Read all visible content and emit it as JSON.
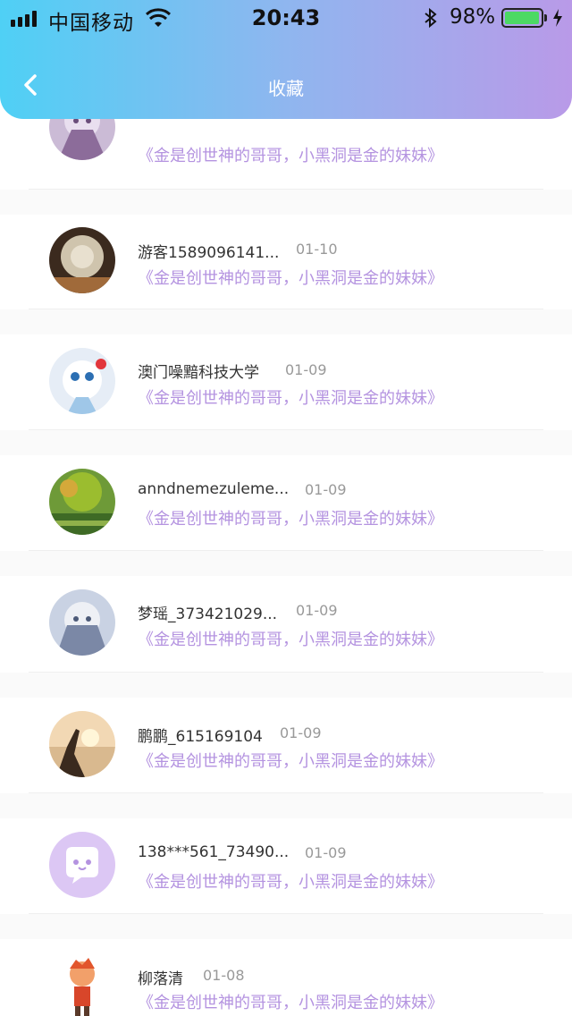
{
  "status_bar": {
    "carrier": "中国移动",
    "time": "20:43",
    "battery": "98%",
    "battery_level": 0.98
  },
  "nav": {
    "back_icon": "chevron-left-icon",
    "title": "收藏"
  },
  "items": [
    {
      "name": "",
      "date": "",
      "quote": "《金是创世神的哥哥，小黑洞是金的妹妹》"
    },
    {
      "name": "游客1589096141...",
      "date": "01-10",
      "quote": "《金是创世神的哥哥，小黑洞是金的妹妹》"
    },
    {
      "name": "澳门噪黯科技大学",
      "date": "01-09",
      "quote": "《金是创世神的哥哥，小黑洞是金的妹妹》"
    },
    {
      "name": "anndnemezuleme...",
      "date": "01-09",
      "quote": "《金是创世神的哥哥，小黑洞是金的妹妹》"
    },
    {
      "name": "梦瑶_373421029...",
      "date": "01-09",
      "quote": "《金是创世神的哥哥，小黑洞是金的妹妹》"
    },
    {
      "name": "鹏鹏_615169104",
      "date": "01-09",
      "quote": "《金是创世神的哥哥，小黑洞是金的妹妹》"
    },
    {
      "name": "138***561_73490...",
      "date": "01-09",
      "quote": "《金是创世神的哥哥，小黑洞是金的妹妹》"
    },
    {
      "name": "柳落清",
      "date": "01-08",
      "quote": "《金是创世神的哥哥，小黑洞是金的妹妹》"
    }
  ]
}
